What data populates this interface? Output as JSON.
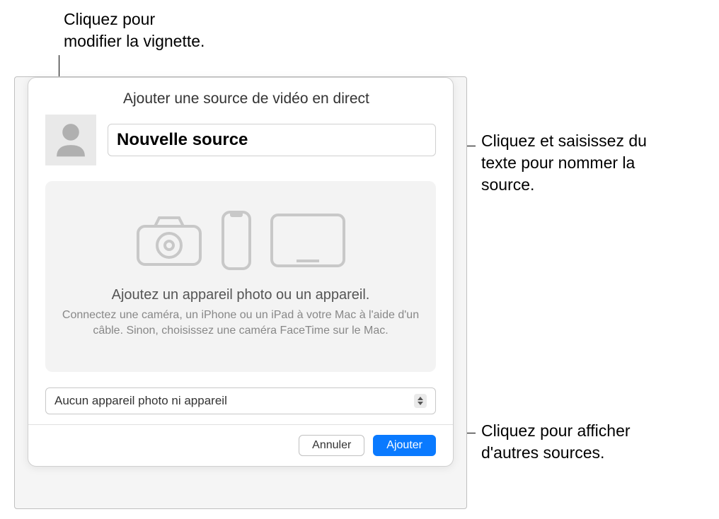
{
  "annotations": {
    "thumbnail": "Cliquez pour\nmodifier la vignette.",
    "name_field": "Cliquez et saisissez du\ntexte pour nommer la\nsource.",
    "dropdown": "Cliquez pour afficher\nd'autres sources."
  },
  "modal": {
    "title": "Ajouter une source de vidéo en direct",
    "source_name": "Nouvelle source",
    "device_area": {
      "title": "Ajoutez un appareil photo ou un appareil.",
      "subtitle": "Connectez une caméra, un iPhone ou un iPad à votre Mac à l'aide d'un câble. Sinon, choisissez une caméra FaceTime sur le Mac."
    },
    "dropdown": {
      "selected": "Aucun appareil photo ni appareil"
    },
    "buttons": {
      "cancel": "Annuler",
      "add": "Ajouter"
    }
  }
}
